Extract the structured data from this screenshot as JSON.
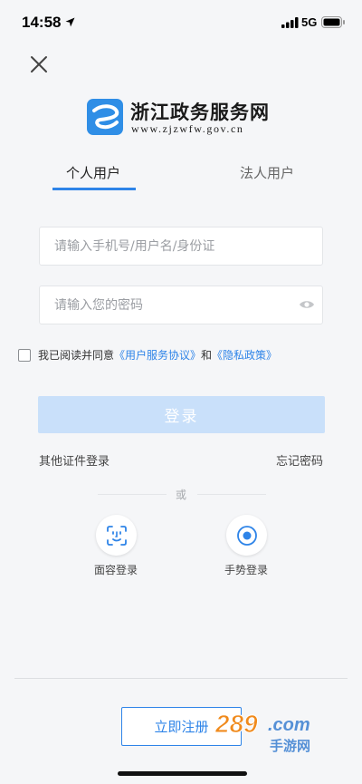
{
  "status_bar": {
    "time": "14:58",
    "network": "5G"
  },
  "logo": {
    "title": "浙江政务服务网",
    "url": "www.zjzwfw.gov.cn"
  },
  "tabs": [
    {
      "label": "个人用户",
      "active": true
    },
    {
      "label": "法人用户",
      "active": false
    }
  ],
  "form": {
    "username_placeholder": "请输入手机号/用户名/身份证",
    "password_placeholder": "请输入您的密码",
    "username_value": "",
    "password_value": ""
  },
  "agreement": {
    "prefix": "我已阅读并同意",
    "service_link": "《用户服务协议》",
    "and": "和",
    "privacy_link": "《隐私政策》",
    "checked": false
  },
  "login_button": "登录",
  "other_login": "其他证件登录",
  "forgot_password": "忘记密码",
  "divider_or": "或",
  "alt_logins": {
    "face": "面容登录",
    "gesture": "手势登录"
  },
  "register_button": "立即注册",
  "watermark": {
    "top": "289.com",
    "bottom": "手游网"
  },
  "colors": {
    "accent": "#2e84e8",
    "login_disabled": "#c9e0fa",
    "background": "#f5f6f8"
  }
}
